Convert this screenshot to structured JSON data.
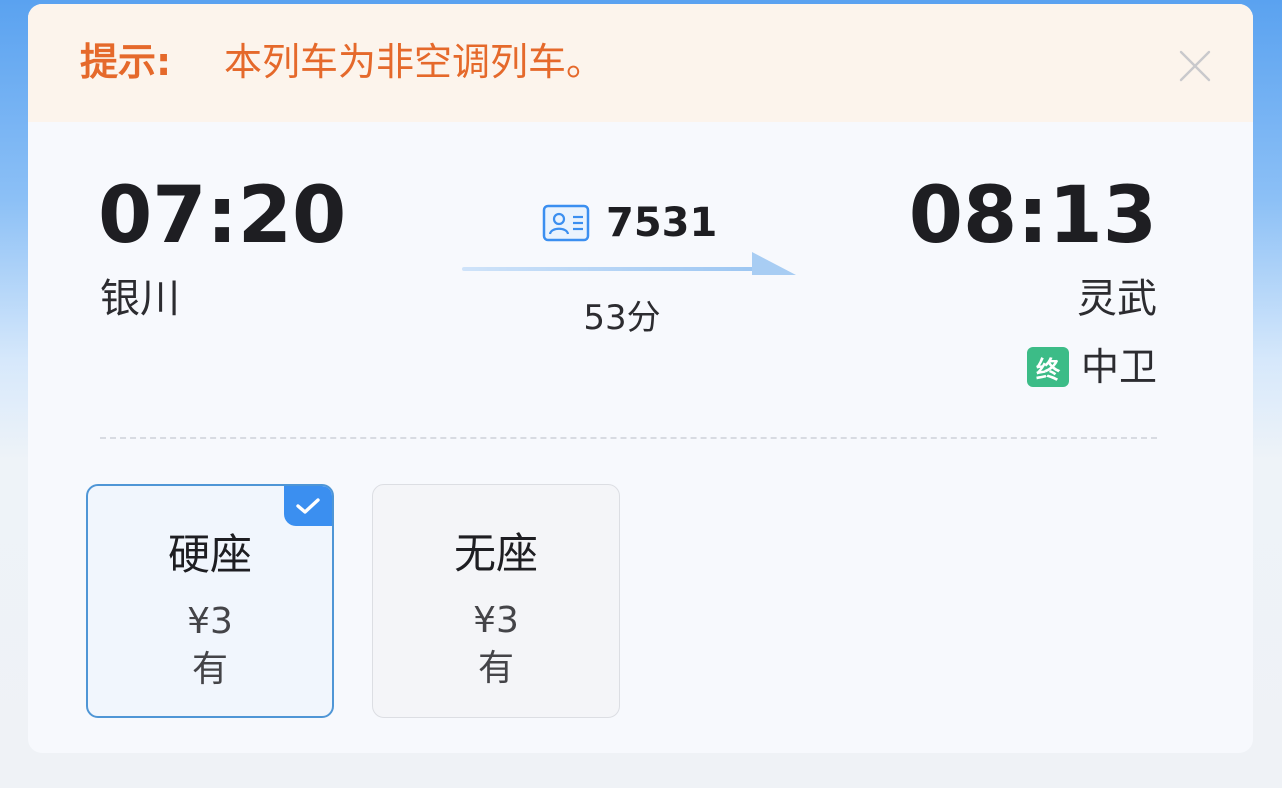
{
  "notice": {
    "label": "提示:",
    "text": "本列车为非空调列车。",
    "close_icon": "close-icon"
  },
  "journey": {
    "departure": {
      "time": "07:20",
      "station": "银川"
    },
    "arrival": {
      "time": "08:13",
      "station": "灵武"
    },
    "train_number": "7531",
    "train_icon": "id-card-icon",
    "duration": "53分",
    "terminal": {
      "badge": "终",
      "station": "中卫"
    }
  },
  "seats": [
    {
      "name": "硬座",
      "price": "¥3",
      "availability": "有",
      "selected": true
    },
    {
      "name": "无座",
      "price": "¥3",
      "availability": "有",
      "selected": false
    }
  ],
  "colors": {
    "notice_text": "#e5692b",
    "notice_bg": "#fcf4ec",
    "accent_blue": "#3b8ff0",
    "terminal_green": "#3cbc87"
  }
}
